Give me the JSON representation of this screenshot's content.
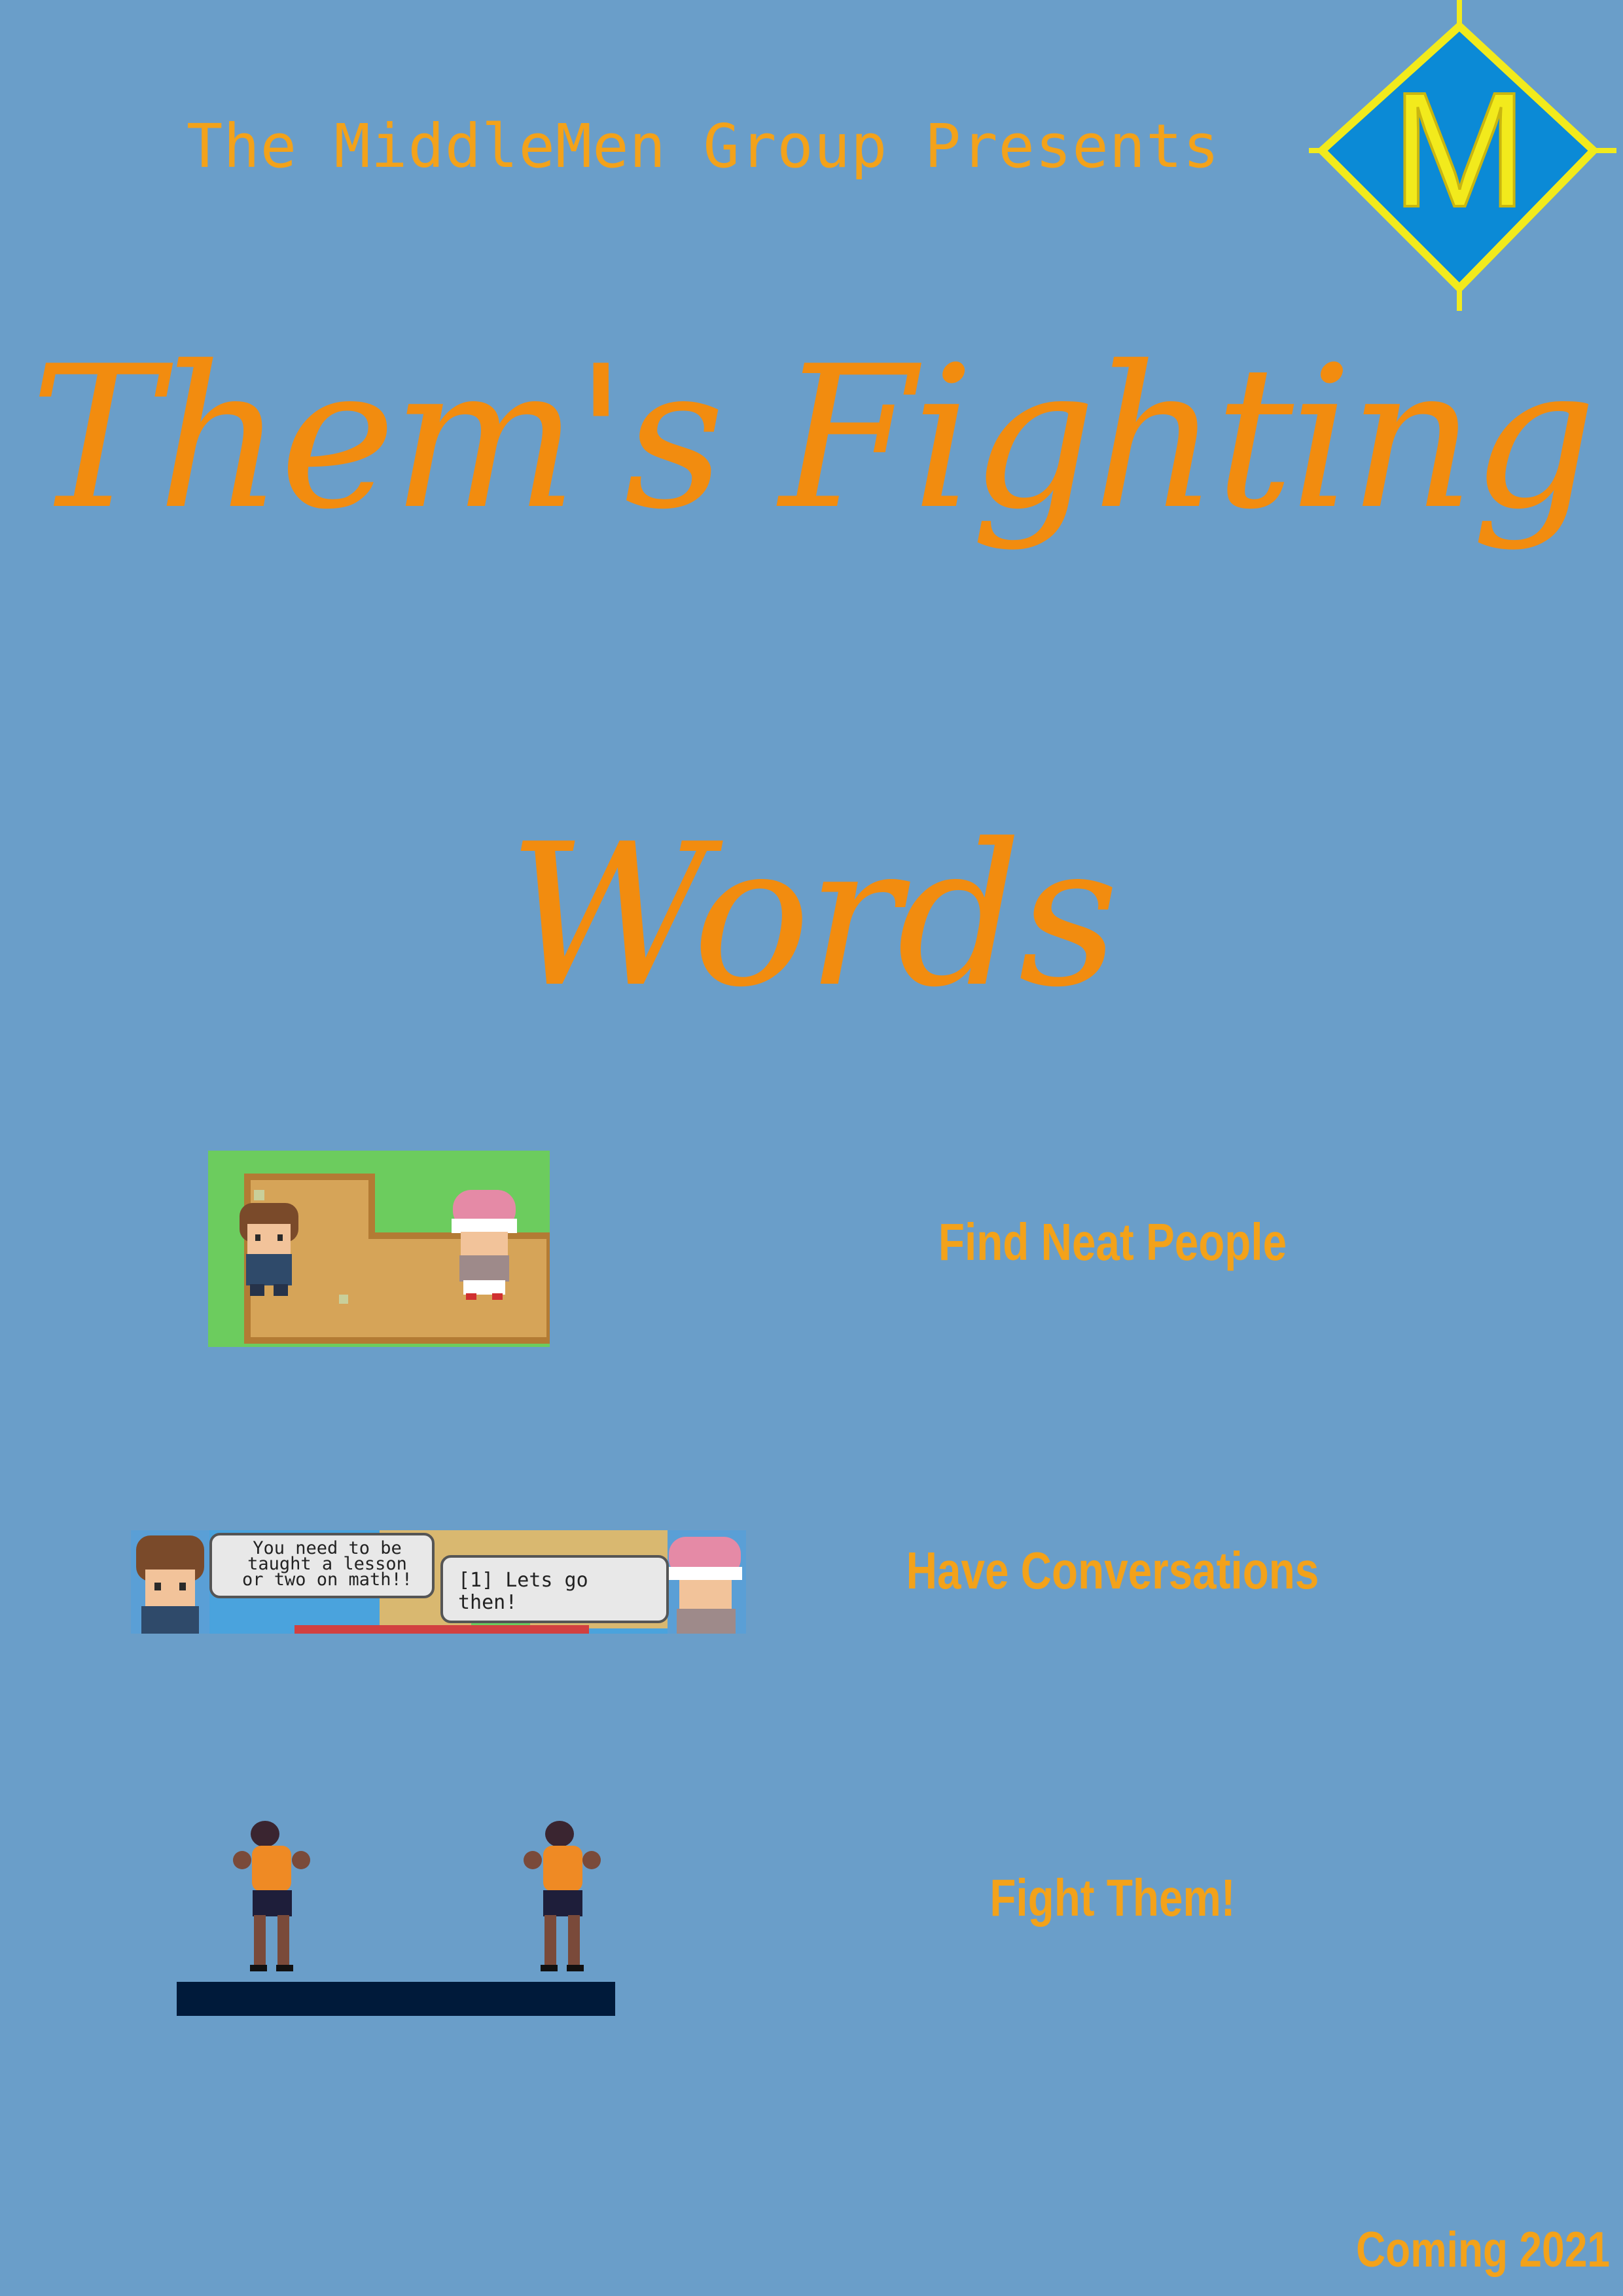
{
  "header": {
    "presents": "The MiddleMen Group Presents",
    "logo_letter": "M"
  },
  "title": {
    "line1": "Them's Fighting",
    "line2": "Words"
  },
  "features": [
    {
      "label": "Find Neat People",
      "image_icon": "overworld-two-characters-icon"
    },
    {
      "label": "Have Conversations",
      "image_icon": "dialogue-boxes-icon"
    },
    {
      "label": "Fight Them!",
      "image_icon": "two-boxers-icon"
    }
  ],
  "dialogue": {
    "speech_line1": "You need to be",
    "speech_line2": "taught a lesson",
    "speech_line3": "or two on math!!",
    "reply_line1": "[1] Lets go",
    "reply_line2": "then!"
  },
  "footer": {
    "coming": "Coming 2021"
  },
  "colors": {
    "background": "#6a9ec9",
    "title_orange": "#f28c0f",
    "text_orange": "#f3a21a",
    "logo_blue": "#0b8ad6",
    "logo_yellow": "#f2ea1c"
  }
}
